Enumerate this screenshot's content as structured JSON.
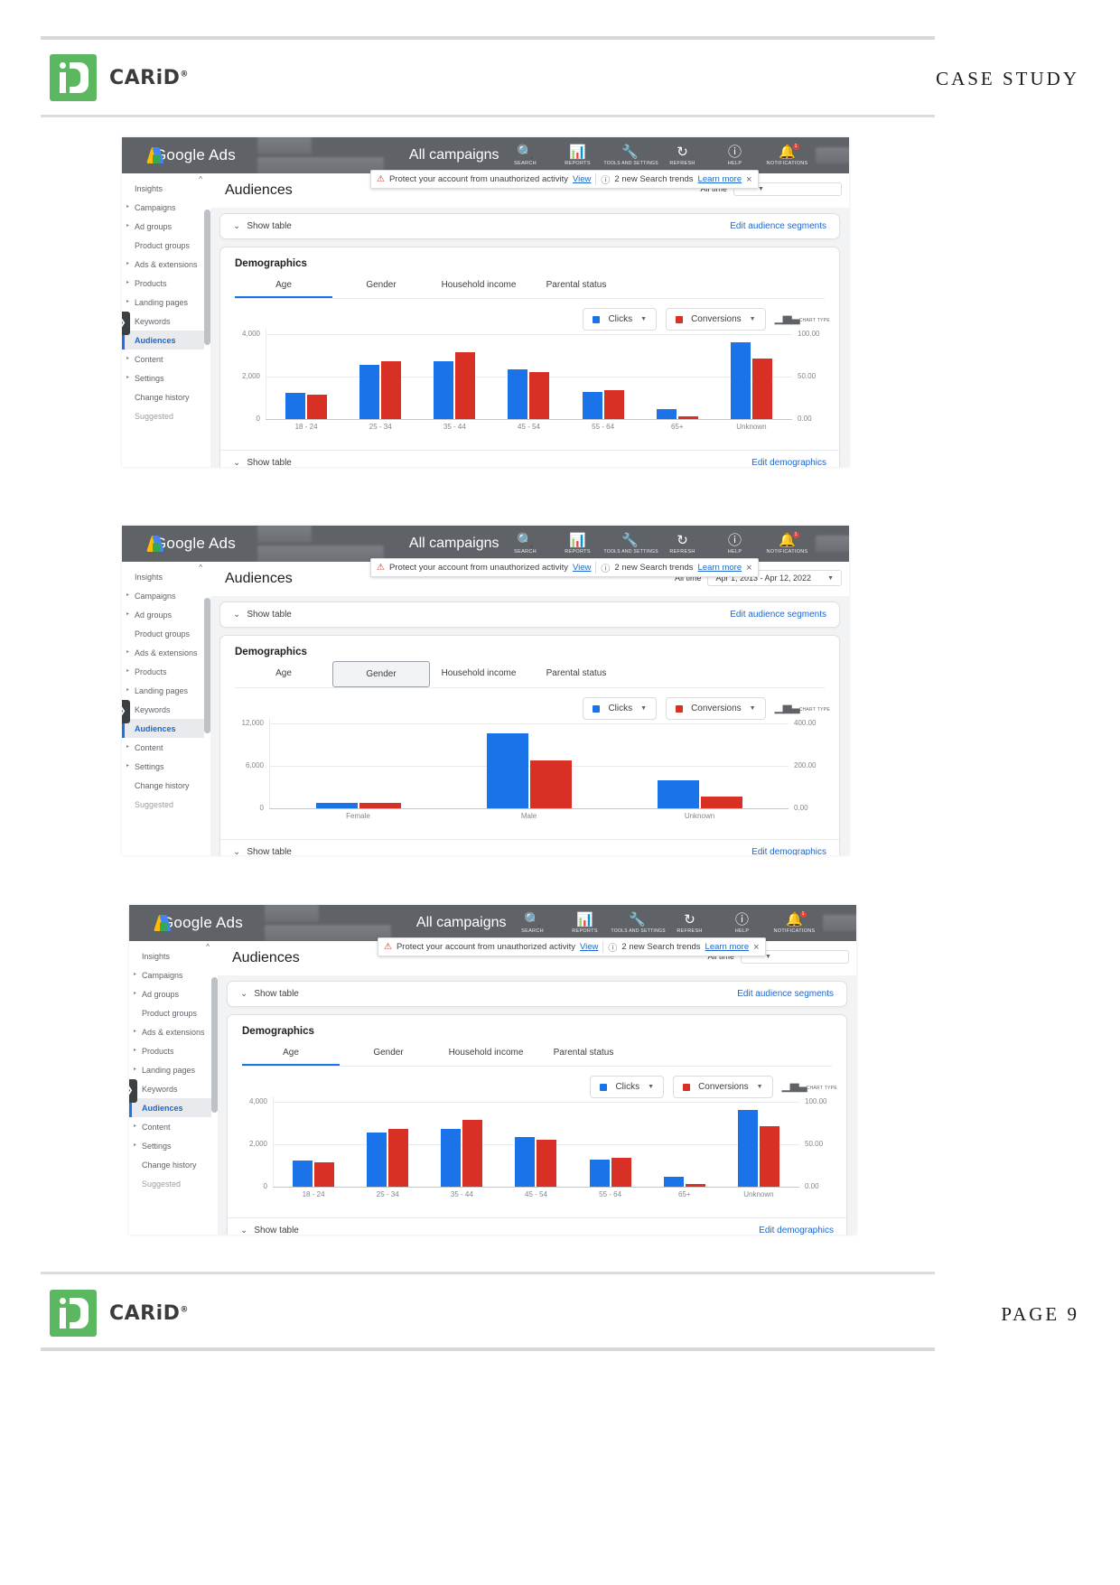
{
  "document": {
    "header_label": "CASE STUDY",
    "footer_label": "PAGE  9",
    "brand_name": "CARiD",
    "brand_trademark": "®"
  },
  "app": {
    "product_name": "Google Ads",
    "campaign_selector": "All campaigns",
    "account_redacted": "",
    "top_icons": [
      {
        "name": "search-icon",
        "glyph": "⌕",
        "caption": "SEARCH",
        "badge": ""
      },
      {
        "name": "reports-icon",
        "glyph": "▦",
        "caption": "REPORTS",
        "badge": ""
      },
      {
        "name": "tools-and-settings-icon",
        "glyph": "⚒",
        "caption": "TOOLS AND SETTINGS",
        "badge": ""
      },
      {
        "name": "refresh-icon",
        "glyph": "⟳",
        "caption": "REFRESH",
        "badge": ""
      },
      {
        "name": "help-icon",
        "glyph": "?",
        "caption": "HELP",
        "badge": ""
      },
      {
        "name": "notifications-icon",
        "glyph": "ὑ4",
        "caption": "NOTIFICATIONS",
        "badge": "1"
      }
    ],
    "notifications": {
      "security_text": "Protect your account from unauthorized activity",
      "security_link": "View",
      "trends_text": "2 new Search trends",
      "trends_link": "Learn more",
      "close": "×"
    },
    "sidebar": [
      {
        "label": "Insights",
        "expandable": false,
        "active": false
      },
      {
        "label": "Campaigns",
        "expandable": true,
        "active": false
      },
      {
        "label": "Ad groups",
        "expandable": true,
        "active": false
      },
      {
        "label": "Product groups",
        "expandable": false,
        "active": false
      },
      {
        "label": "Ads & extensions",
        "expandable": true,
        "active": false
      },
      {
        "label": "Products",
        "expandable": true,
        "active": false
      },
      {
        "label": "Landing pages",
        "expandable": true,
        "active": false
      },
      {
        "label": "Keywords",
        "expandable": true,
        "active": false
      },
      {
        "label": "Audiences",
        "expandable": false,
        "active": true
      },
      {
        "label": "Content",
        "expandable": true,
        "active": false
      },
      {
        "label": "Settings",
        "expandable": true,
        "active": false
      },
      {
        "label": "Change history",
        "expandable": false,
        "active": false
      },
      {
        "label": "Suggested",
        "expandable": false,
        "active": false,
        "muted": true
      }
    ],
    "page_title": "Audiences",
    "date_all_time": "All time",
    "date_range_value": "Apr 1, 2013 - Apr 12, 2022",
    "show_table": "Show table",
    "edit_audience_segments": "Edit audience segments",
    "edit_demographics": "Edit demographics",
    "demographics_title": "Demographics",
    "demographic_tabs": [
      "Age",
      "Gender",
      "Household income",
      "Parental status"
    ],
    "metric_primary": "Clicks",
    "metric_secondary": "Conversions",
    "chart_type_caption": "CHART TYPE",
    "colors": {
      "clicks": "#1a73e8",
      "conversions": "#d93025",
      "topbar": "#5f6368",
      "link": "#1967d2",
      "brand_green": "#5cb860"
    }
  },
  "chart_data": [
    {
      "id": "age-chart-top",
      "type": "bar",
      "title": "Demographics - Age",
      "xlabel": "",
      "ylabel": "Clicks",
      "y2label": "Conversions",
      "categories": [
        "18 - 24",
        "25 - 34",
        "35 - 44",
        "45 - 54",
        "55 - 64",
        "65+",
        "Unknown"
      ],
      "yticks": [
        "0",
        "2,000",
        "4,000"
      ],
      "y2ticks": [
        "0.00",
        "50.00",
        "100.00"
      ],
      "ylim": [
        0,
        4600
      ],
      "y2lim": [
        0,
        115
      ],
      "grid": true,
      "legend_position": "top-right",
      "series": [
        {
          "name": "Clicks",
          "color": "#1a73e8",
          "values": [
            1350,
            2750,
            2950,
            2550,
            1380,
            490,
            3930
          ]
        },
        {
          "name": "Conversions",
          "color": "#d93025",
          "values": [
            31.5,
            73.5,
            85.0,
            60.0,
            36.5,
            4.0,
            77.5
          ]
        }
      ]
    },
    {
      "id": "gender-chart-middle",
      "type": "bar",
      "title": "Demographics - Gender",
      "xlabel": "",
      "ylabel": "Clicks",
      "y2label": "Conversions",
      "categories": [
        "Female",
        "Male",
        "Unknown"
      ],
      "yticks": [
        "0",
        "6,000",
        "12,000"
      ],
      "y2ticks": [
        "0.00",
        "200.00",
        "400.00"
      ],
      "ylim": [
        0,
        13500
      ],
      "y2lim": [
        0,
        450
      ],
      "grid": true,
      "legend_position": "top-right",
      "series": [
        {
          "name": "Clicks",
          "color": "#1a73e8",
          "values": [
            820,
            11200,
            4250
          ]
        },
        {
          "name": "Conversions",
          "color": "#d93025",
          "values": [
            26,
            240,
            57
          ]
        }
      ]
    },
    {
      "id": "age-chart-bottom",
      "type": "bar",
      "title": "Demographics - Age",
      "xlabel": "",
      "ylabel": "Clicks",
      "y2label": "Conversions",
      "categories": [
        "18 - 24",
        "25 - 34",
        "35 - 44",
        "45 - 54",
        "55 - 64",
        "65+",
        "Unknown"
      ],
      "yticks": [
        "0",
        "2,000",
        "4,000"
      ],
      "y2ticks": [
        "0.00",
        "50.00",
        "100.00"
      ],
      "ylim": [
        0,
        4600
      ],
      "y2lim": [
        0,
        115
      ],
      "grid": true,
      "legend_position": "top-right",
      "series": [
        {
          "name": "Clicks",
          "color": "#1a73e8",
          "values": [
            1350,
            2750,
            2950,
            2550,
            1380,
            490,
            3930
          ]
        },
        {
          "name": "Conversions",
          "color": "#d93025",
          "values": [
            31.5,
            73.5,
            85.0,
            60.0,
            36.5,
            4.0,
            77.5
          ]
        }
      ]
    }
  ]
}
